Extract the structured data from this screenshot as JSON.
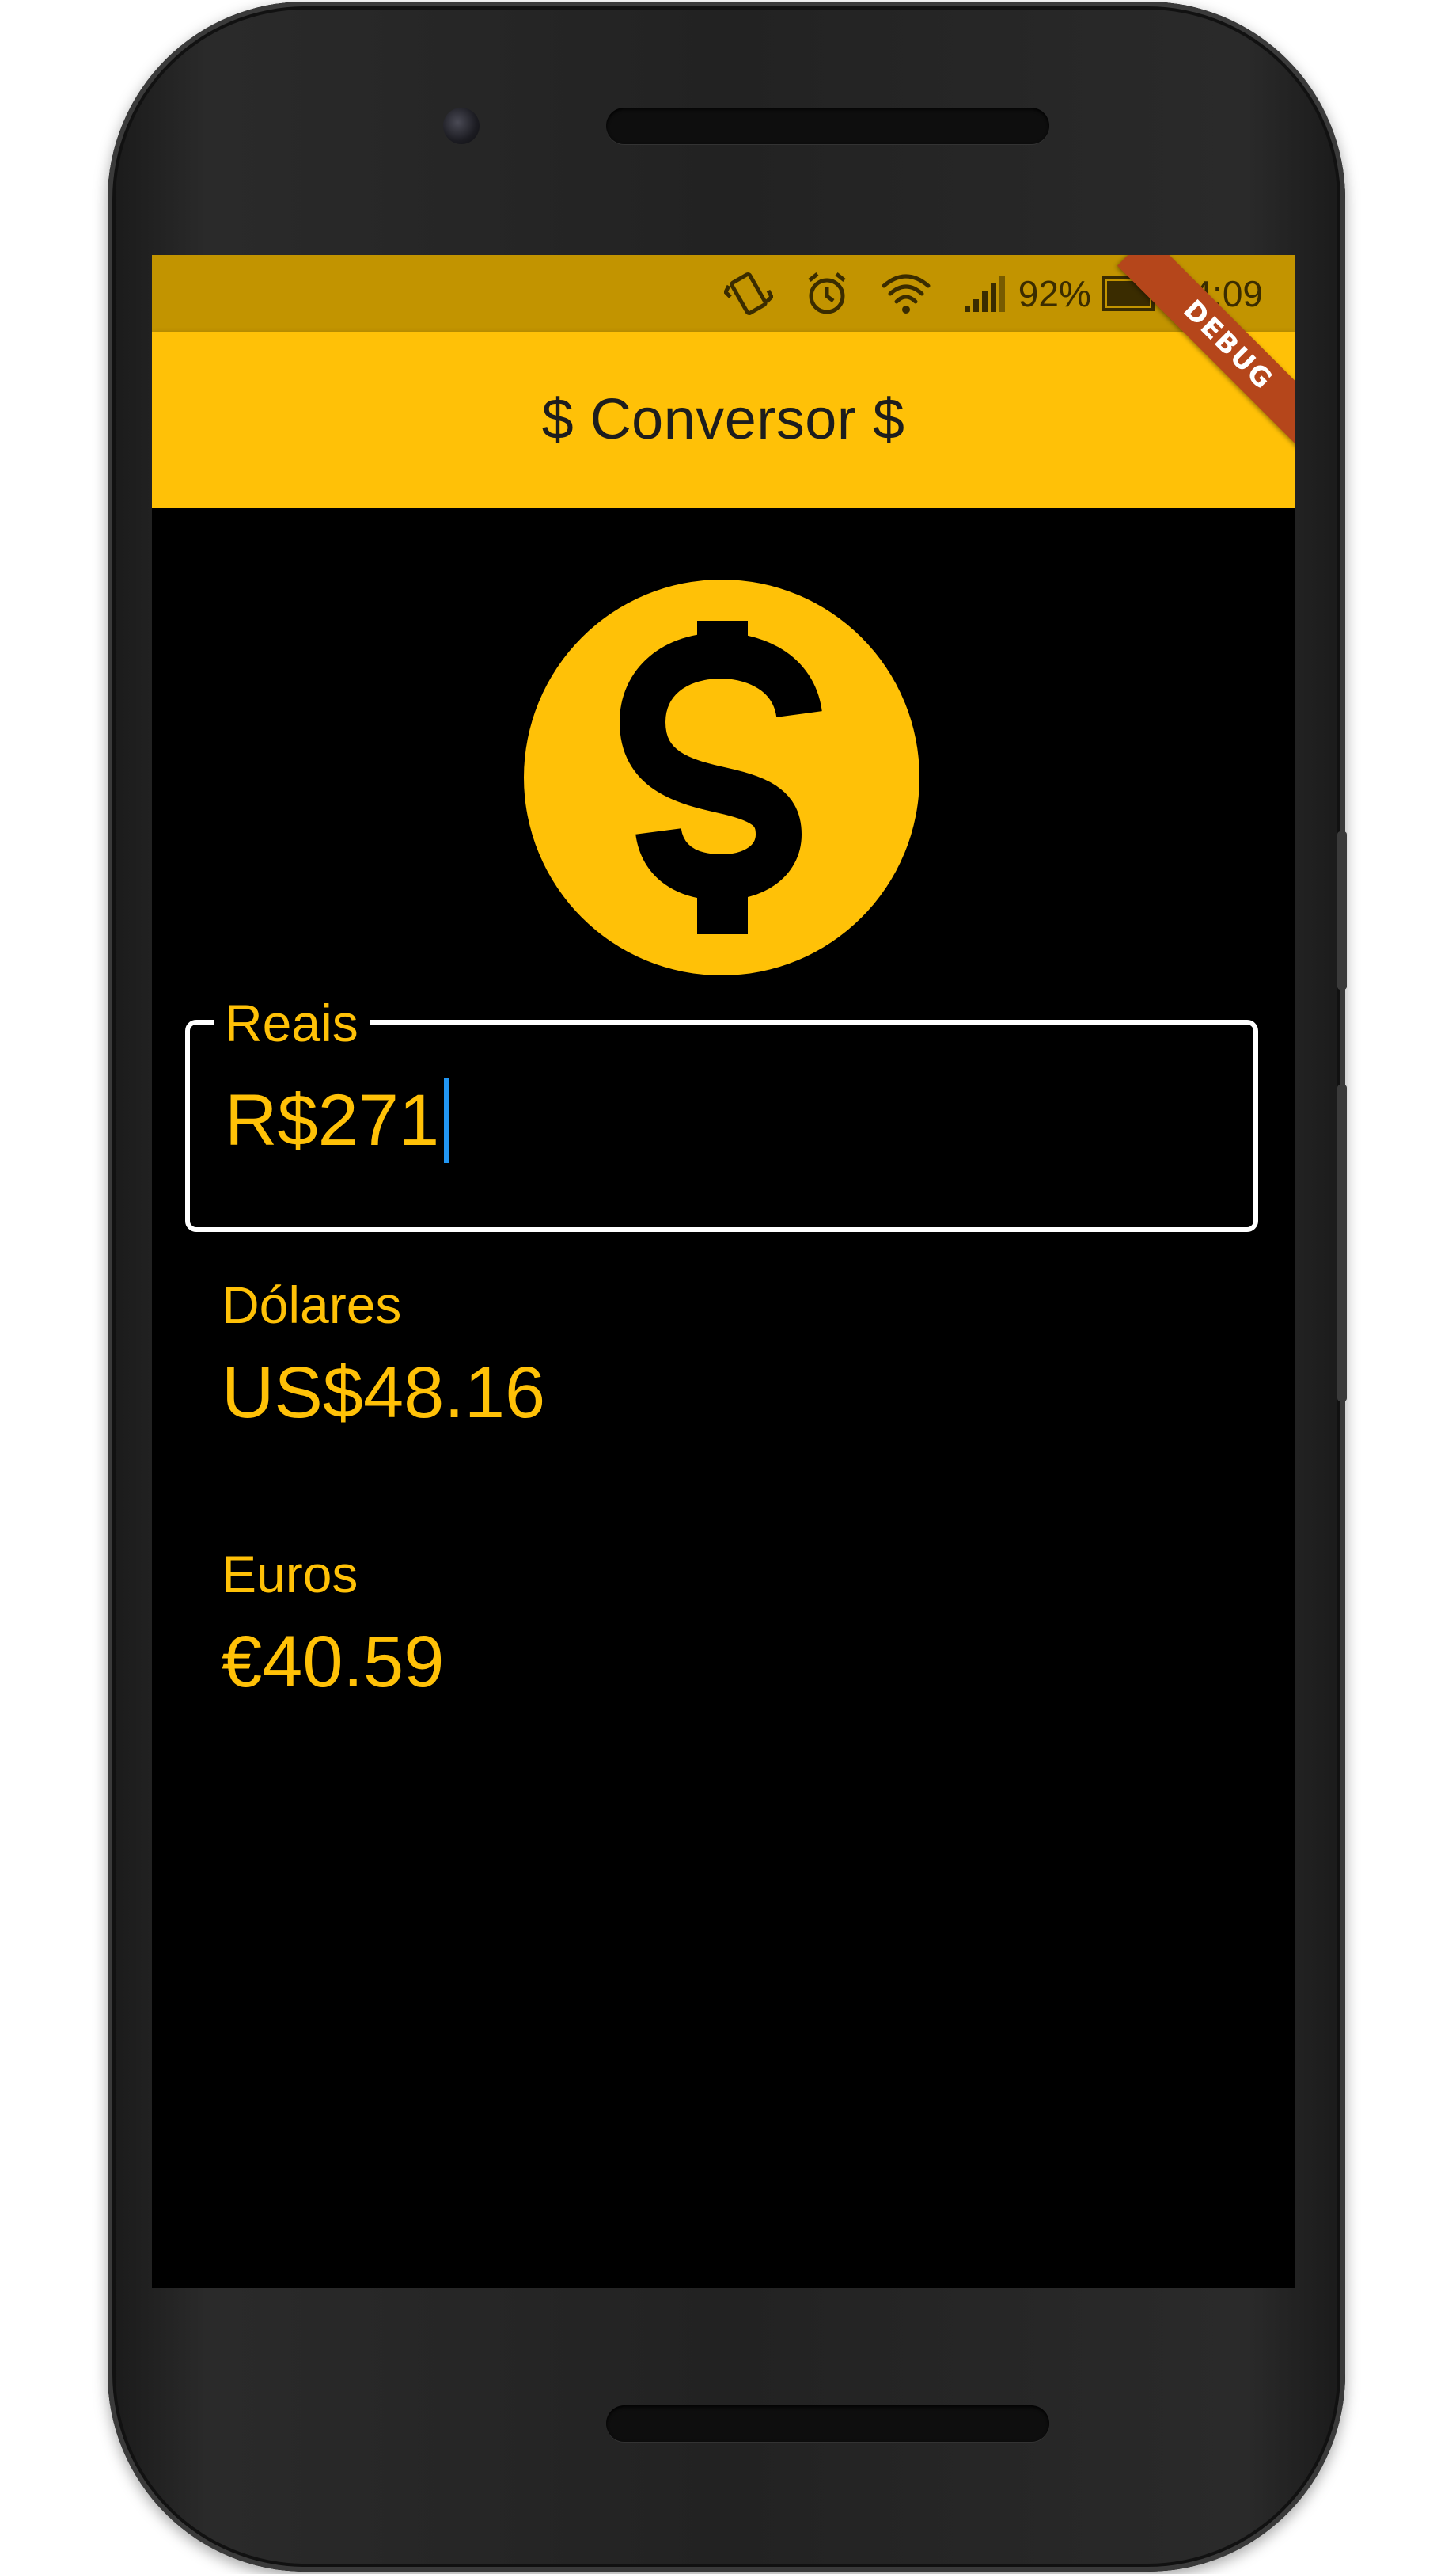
{
  "status_bar": {
    "battery_percent": "92%",
    "time": "14:09",
    "icons": [
      "vibrate-icon",
      "alarm-icon",
      "wifi-icon",
      "signal-icon",
      "battery-icon"
    ]
  },
  "debug_banner": "DEBUG",
  "app_bar": {
    "title": "$ Conversor $"
  },
  "main": {
    "icon": "dollar-coin-icon",
    "reais": {
      "label": "Reais",
      "value": "R$271"
    },
    "dolares": {
      "label": "Dólares",
      "value": "US$48.16"
    },
    "euros": {
      "label": "Euros",
      "value": "€40.59"
    }
  },
  "colors": {
    "accent": "#ffc107",
    "status_bar": "#c29400",
    "background": "#000000",
    "cursor": "#2196f3",
    "debug_banner": "#b5461b"
  }
}
